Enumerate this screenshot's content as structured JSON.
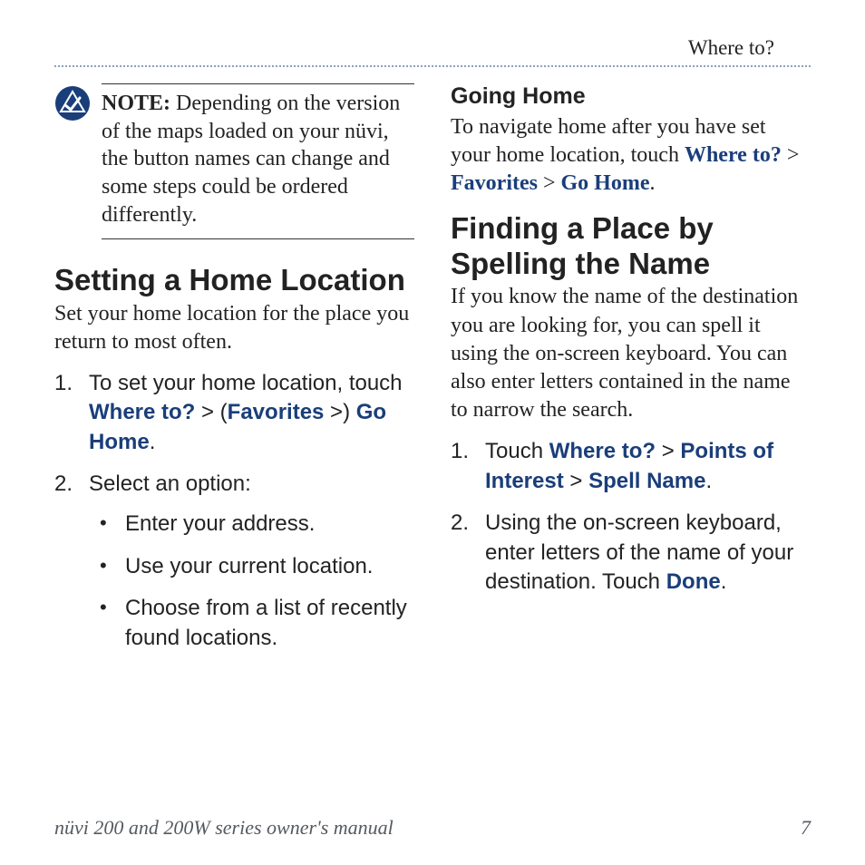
{
  "running_head": "Where to?",
  "note": {
    "label": "NOTE:",
    "text": " Depending on the version of the maps loaded on your nüvi, the button names can change and some steps could be ordered differently."
  },
  "left": {
    "h": "Setting a Home Location",
    "intro": "Set your home location for the place you return to most often.",
    "step1_a": "To set your home location, touch ",
    "nav": {
      "where": "Where to?",
      "fav": "Favorites",
      "go": "Go Home"
    },
    "step2": "Select an option:",
    "opts": {
      "a": "Enter your address.",
      "b": "Use your current location.",
      "c": "Choose from a list of recently found locations."
    }
  },
  "right": {
    "goinghome_h": "Going Home",
    "goinghome_a": "To navigate home after you have set your home location, touch ",
    "nav1": {
      "where": "Where to?",
      "fav": "Favorites",
      "go": "Go Home"
    },
    "finding_h": "Finding a Place by Spelling the Name",
    "finding_p": "If you know the name of the destination you are looking for, you can spell it using the on-screen keyboard. You can also enter letters contained in the name to narrow the search.",
    "step1_a": "Touch ",
    "nav2": {
      "where": "Where to?",
      "poi": "Points of Interest",
      "spell": "Spell Name"
    },
    "step2_a": "Using the on-screen keyboard, enter letters of the name of your destination. Touch ",
    "done": "Done"
  },
  "footer": {
    "title": "nüvi 200 and 200W series owner's manual",
    "page": "7"
  },
  "glyphs": {
    "gt": " > "
  }
}
